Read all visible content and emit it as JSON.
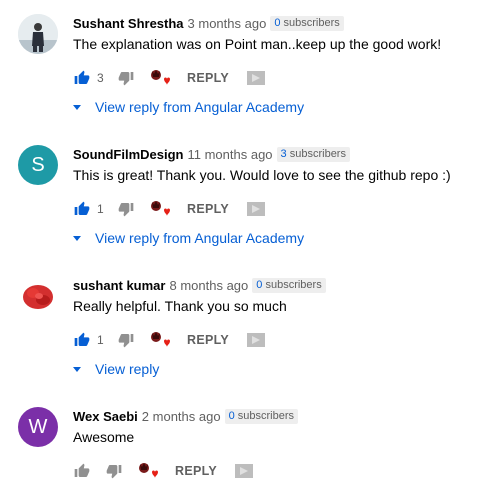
{
  "comments": [
    {
      "author": "Sushant Shrestha",
      "time": "3 months ago",
      "subs_count": "0",
      "subs_label": "subscribers",
      "text": "The explanation was on Point man..keep up the good work!",
      "likes": "3",
      "reply_label": "REPLY",
      "view_reply": "View reply from Angular Academy",
      "avatar_type": "photo",
      "avatar_color": "#cfd8dc"
    },
    {
      "author": "SoundFilmDesign",
      "time": "11 months ago",
      "subs_count": "3",
      "subs_label": "subscribers",
      "text": "This is great!  Thank you.  Would love to see the github repo :)",
      "likes": "1",
      "reply_label": "REPLY",
      "view_reply": "View reply from Angular Academy",
      "avatar_letter": "S",
      "avatar_color": "#1e9aa6"
    },
    {
      "author": "sushant kumar",
      "time": "8 months ago",
      "subs_count": "0",
      "subs_label": "subscribers",
      "text": "Really helpful. Thank you so much",
      "likes": "1",
      "reply_label": "REPLY",
      "view_reply": "View reply",
      "avatar_type": "red-photo",
      "avatar_color": "#d32f2f"
    },
    {
      "author": "Wex Saebi",
      "time": "2 months ago",
      "subs_count": "0",
      "subs_label": "subscribers",
      "text": "Awesome",
      "likes": "",
      "reply_label": "REPLY",
      "avatar_letter": "W",
      "avatar_color": "#7b2fa8"
    }
  ],
  "colors": {
    "link": "#065fd4",
    "like_active": "#065fd4",
    "like_inactive": "#909090",
    "heart": "#e62117"
  },
  "icons": [
    "thumbs-up-icon",
    "thumbs-down-icon",
    "creator-heart-icon",
    "flag-icon",
    "caret-down-icon"
  ]
}
